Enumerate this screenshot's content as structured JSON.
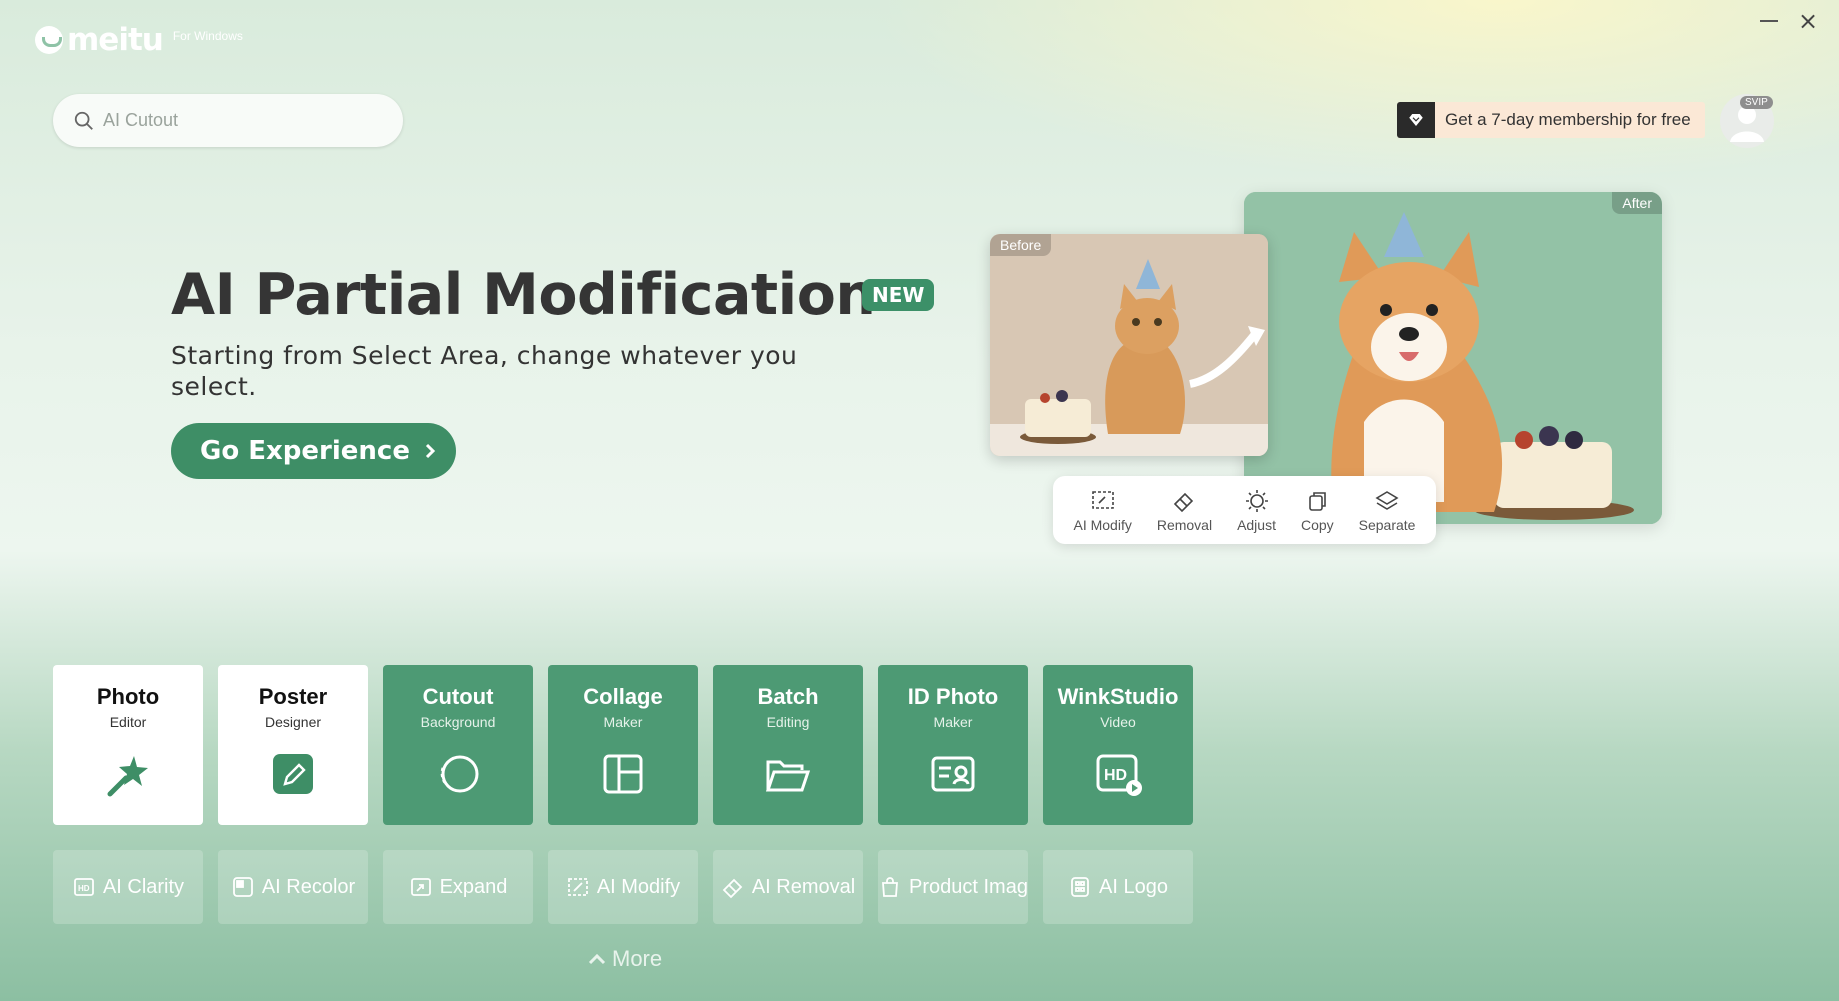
{
  "app": {
    "logo_text": "meitu",
    "logo_sub": "For Windows"
  },
  "window_controls": {
    "minimize": "minimize-icon",
    "close": "close-icon"
  },
  "search": {
    "placeholder": "AI Cutout",
    "icon": "search-icon"
  },
  "promo": {
    "text": "Get a 7-day membership for free",
    "icon": "diamond-icon"
  },
  "user": {
    "badge": "SVIP",
    "avatar": "avatar-icon"
  },
  "hero": {
    "title": "AI Partial Modification",
    "badge": "NEW",
    "subtitle": "Starting from Select Area, change whatever you select.",
    "cta_label": "Go Experience",
    "cta_icon": "chevron-right-icon",
    "before_label": "Before",
    "after_label": "After",
    "tools": [
      {
        "label": "AI Modify",
        "icon": "ai-modify-icon"
      },
      {
        "label": "Removal",
        "icon": "eraser-icon"
      },
      {
        "label": "Adjust",
        "icon": "sun-icon"
      },
      {
        "label": "Copy",
        "icon": "copy-icon"
      },
      {
        "label": "Separate",
        "icon": "layers-icon"
      }
    ]
  },
  "tiles": [
    {
      "title": "Photo",
      "subtitle": "Editor",
      "icon": "magic-wand-icon",
      "style": "white"
    },
    {
      "title": "Poster",
      "subtitle": "Designer",
      "icon": "edit-pencil-icon",
      "style": "white"
    },
    {
      "title": "Cutout",
      "subtitle": "Background",
      "icon": "lasso-icon",
      "style": "green"
    },
    {
      "title": "Collage",
      "subtitle": "Maker",
      "icon": "grid-layout-icon",
      "style": "green"
    },
    {
      "title": "Batch",
      "subtitle": "Editing",
      "icon": "folder-icon",
      "style": "green"
    },
    {
      "title": "ID Photo",
      "subtitle": "Maker",
      "icon": "id-card-icon",
      "style": "green"
    },
    {
      "title": "WinkStudio",
      "subtitle": "Video",
      "icon": "hd-video-icon",
      "style": "green"
    }
  ],
  "quick_tools": [
    {
      "label": "AI Clarity",
      "icon": "hd-icon"
    },
    {
      "label": "AI Recolor",
      "icon": "recolor-icon"
    },
    {
      "label": "Expand",
      "icon": "expand-icon"
    },
    {
      "label": "AI Modify",
      "icon": "ai-modify-icon"
    },
    {
      "label": "AI Removal",
      "icon": "eraser-icon"
    },
    {
      "label": "Product Imag",
      "icon": "product-icon"
    },
    {
      "label": "AI Logo",
      "icon": "logo-icon"
    }
  ],
  "more": {
    "label": "More",
    "icon": "chevron-up-icon"
  },
  "colors": {
    "brand_green": "#3e8e66",
    "tile_green": "#4d9a74",
    "promo_bg": "#fbe8d6"
  }
}
